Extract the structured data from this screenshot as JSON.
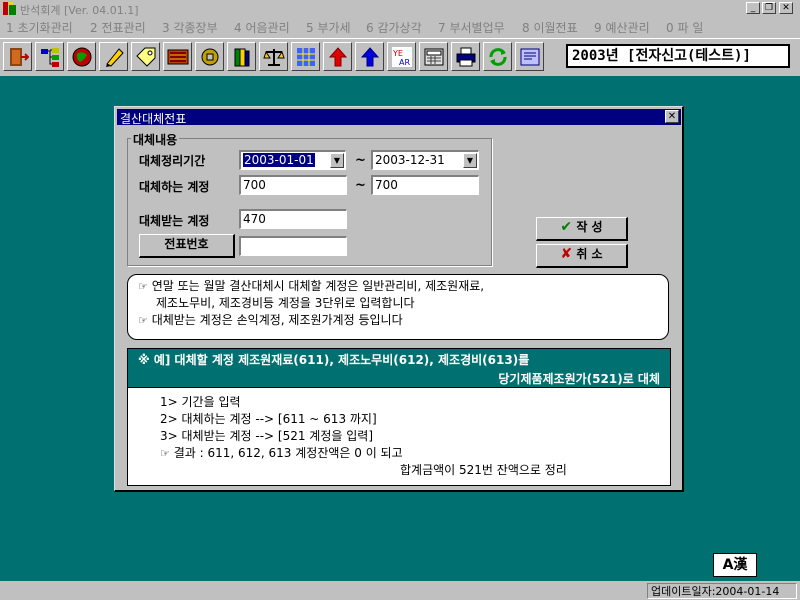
{
  "window": {
    "title": "반석회계 [Ver. 04.01.1]",
    "controls": [
      "_",
      "❐",
      "✕"
    ]
  },
  "menu": [
    {
      "num": "1",
      "label": "초기화관리"
    },
    {
      "num": "2",
      "label": "전표관리"
    },
    {
      "num": "3",
      "label": "각종장부"
    },
    {
      "num": "4",
      "label": "어음관리"
    },
    {
      "num": "5",
      "label": "부가세"
    },
    {
      "num": "6",
      "label": "감가상각"
    },
    {
      "num": "7",
      "label": "부서별업무"
    },
    {
      "num": "8",
      "label": "이월전표"
    },
    {
      "num": "9",
      "label": "예산관리"
    },
    {
      "num": "0",
      "label": "파 일"
    }
  ],
  "toolbar": {
    "icons": [
      "exit-icon",
      "org-chart-icon",
      "globe-icon",
      "pencil-icon",
      "tag-icon",
      "abacus-icon",
      "coin-icon",
      "books-icon",
      "scale-icon",
      "grid-icon",
      "arrow-up-red-icon",
      "arrow-up-blue-icon",
      "year-icon",
      "calculator-icon",
      "printer-icon",
      "refresh-icon",
      "document-icon"
    ],
    "company": "2003년 [전자신고(테스트)]"
  },
  "dialog": {
    "title": "결산대체전표",
    "close": "✕",
    "group_title": "대체내용",
    "period_label": "대체정리기간",
    "period_from": "2003-01-01",
    "period_to": "2003-12-31",
    "from_account_label": "대체하는 계정",
    "from_account_start": "700",
    "from_account_end": "700",
    "to_account_label": "대체받는 계정",
    "to_account": "470",
    "voucher_button": "전표번호",
    "voucher_value": "",
    "tilde": "~",
    "create_button": "작 성",
    "cancel_button": "취 소",
    "info": [
      "연말 또는 월말 결산대체시 대체할 계정은 일반관리비, 제조원재료,",
      "제조노무비, 제조경비등 계정을 3단위로 입력합니다",
      "대체받는 계정은 손익계정, 제조원가계정 등입니다"
    ],
    "example_header": [
      "※ 예] 대체할 계정 제조원재료(611), 제조노무비(612), 제조경비(613)를",
      "당기제품제조원가(521)로 대체"
    ],
    "example_steps": [
      "1> 기간을 입력",
      "2> 대체하는 계정 --> [611 ~ 613 까지]",
      "3> 대체받는 계정 --> [521 계정을 입력]"
    ],
    "example_result": [
      "결과 : 611, 612, 613 계정잔액은 0 이 되고",
      "합계금액이 521번 잔액으로 정리"
    ]
  },
  "ime": "A漢",
  "status": "업데이트일자:2004-01-14"
}
